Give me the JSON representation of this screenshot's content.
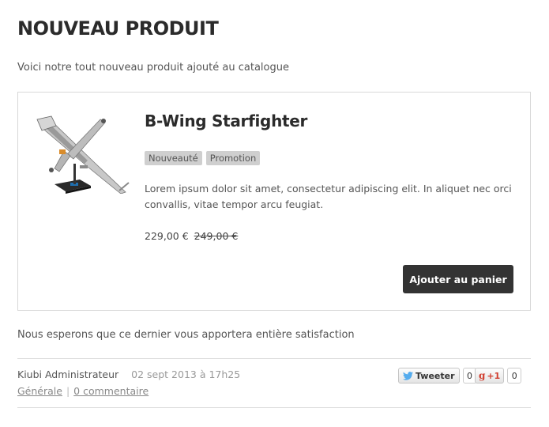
{
  "page": {
    "title": "NOUVEAU PRODUIT",
    "intro": "Voici notre tout nouveau produit ajouté au catalogue",
    "outro": "Nous esperons que ce dernier vous apportera entière satisfaction"
  },
  "product": {
    "name": "B-Wing Starfighter",
    "badges": [
      "Nouveauté",
      "Promotion"
    ],
    "description": "Lorem ipsum dolor sit amet, consectetur adipiscing elit. In aliquet nec orci convallis, vitae tempor arcu feugiat.",
    "price": "229,00 €",
    "old_price": "249,00 €",
    "add_to_cart_label": "Ajouter au panier",
    "image_icon": "starship-model-icon"
  },
  "meta": {
    "author": "Kiubi Administrateur",
    "date": "02 sept 2013 à 17h25",
    "category": "Générale",
    "separator": "|",
    "comments": "0 commentaire"
  },
  "social": {
    "tweet_label": "Tweeter",
    "tweet_count": "0",
    "gplus_label": "+1",
    "gplus_count": "0",
    "twitter_color": "#55acee",
    "gplus_color": "#d23f30"
  }
}
